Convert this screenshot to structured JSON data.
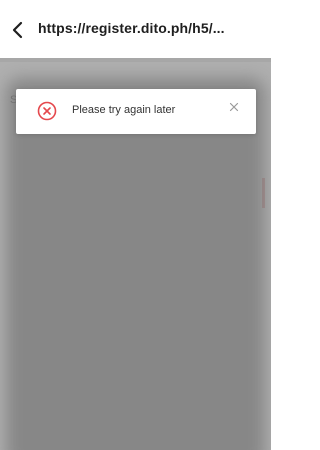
{
  "browser": {
    "url": "https://register.dito.ph/h5/...",
    "back_icon": "chevron-left-icon"
  },
  "page": {
    "hint_text": "S"
  },
  "toast": {
    "message": "Please try again later",
    "status_icon": "error-x-circle-icon",
    "close_icon": "close-icon",
    "accent_color": "#e5484d"
  },
  "colors": {
    "overlay": "#5a5a5a",
    "toast_bg": "#ffffff",
    "text": "#1f1f1f"
  }
}
